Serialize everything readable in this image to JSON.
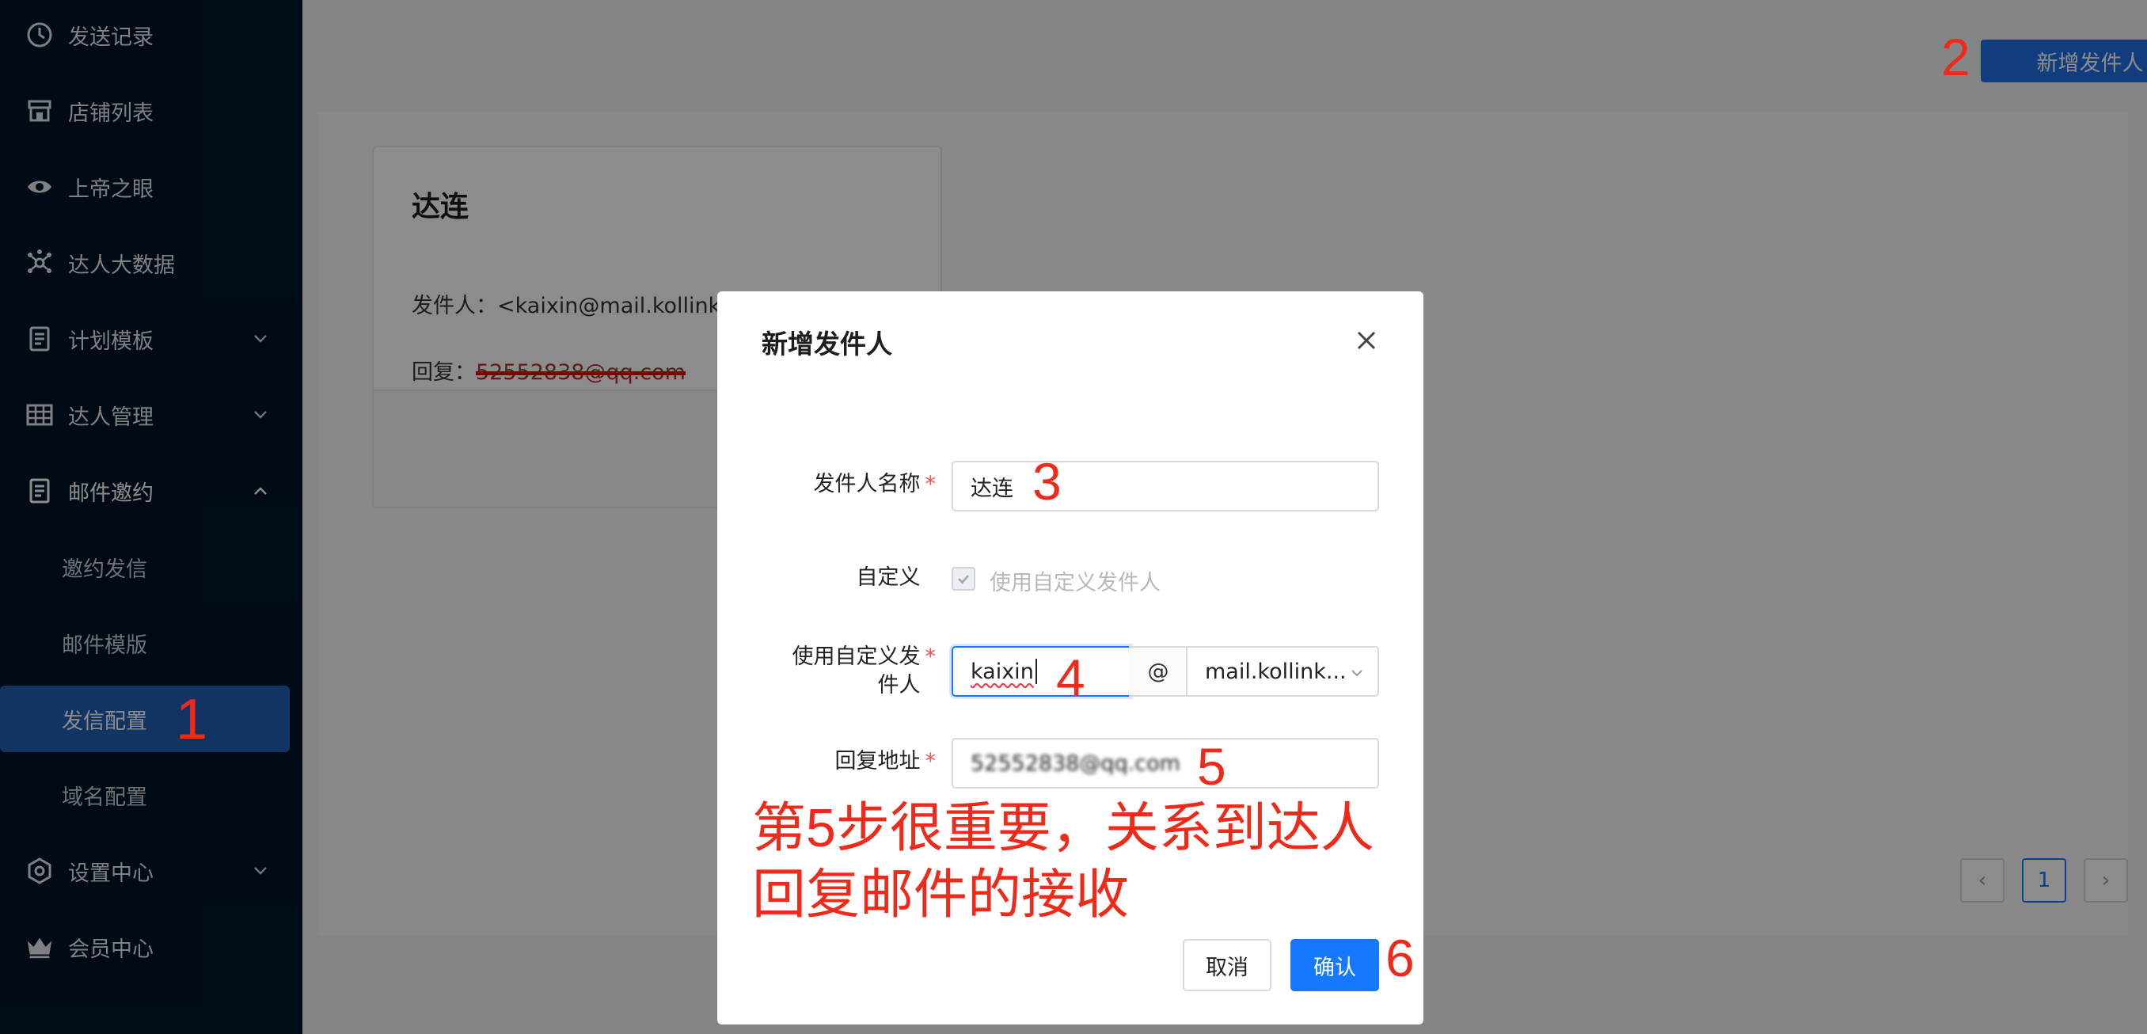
{
  "sidebar": {
    "items": [
      {
        "label": "发送记录",
        "icon": "clock-icon"
      },
      {
        "label": "店铺列表",
        "icon": "store-icon"
      },
      {
        "label": "上帝之眼",
        "icon": "eye-icon"
      },
      {
        "label": "达人大数据",
        "icon": "network-icon"
      },
      {
        "label": "计划模板",
        "icon": "document-icon"
      },
      {
        "label": "达人管理",
        "icon": "table-icon"
      },
      {
        "label": "邮件邀约",
        "icon": "mail-doc-icon"
      },
      {
        "label": "设置中心",
        "icon": "hexagon-settings-icon"
      },
      {
        "label": "会员中心",
        "icon": "crown-icon"
      }
    ],
    "sub_items": [
      {
        "label": "邀约发信"
      },
      {
        "label": "邮件模版"
      },
      {
        "label": "发信配置"
      },
      {
        "label": "域名配置"
      }
    ]
  },
  "main": {
    "add_sender_label": "新增发件人",
    "card": {
      "title": "达连",
      "sender_line": "发件人：<kaixin@mail.kollink.net>",
      "reply_prefix": "回复：",
      "reply_value": "52552838@qq.com"
    },
    "pager": {
      "prev": "‹",
      "current": "1",
      "next": "›"
    }
  },
  "modal": {
    "title": "新增发件人",
    "fields": {
      "name_label": "发件人名称",
      "name_value": "达连",
      "custom_label": "自定义",
      "custom_checkbox_label": "使用自定义发件人",
      "custom_sender_label_1": "使用自定义发",
      "custom_sender_label_2": "件人",
      "custom_sender_value": "kaixin",
      "at_symbol": "@",
      "domain_value": "mail.kollink...",
      "reply_label": "回复地址",
      "reply_value": "52552838@qq.com",
      "required_mark": "*"
    },
    "cancel_label": "取消",
    "ok_label": "确认"
  },
  "annotations": {
    "a1": "1",
    "a2": "2",
    "a3": "3",
    "a4": "4",
    "a5": "5",
    "a6": "6",
    "note_line1": "第5步很重要，关系到达人",
    "note_line2": "回复邮件的接收"
  },
  "colors": {
    "sidebar_bg": "#001529",
    "active_item": "#1f5fb4",
    "primary": "#1677ff",
    "annotation_red": "#f02a1a"
  }
}
